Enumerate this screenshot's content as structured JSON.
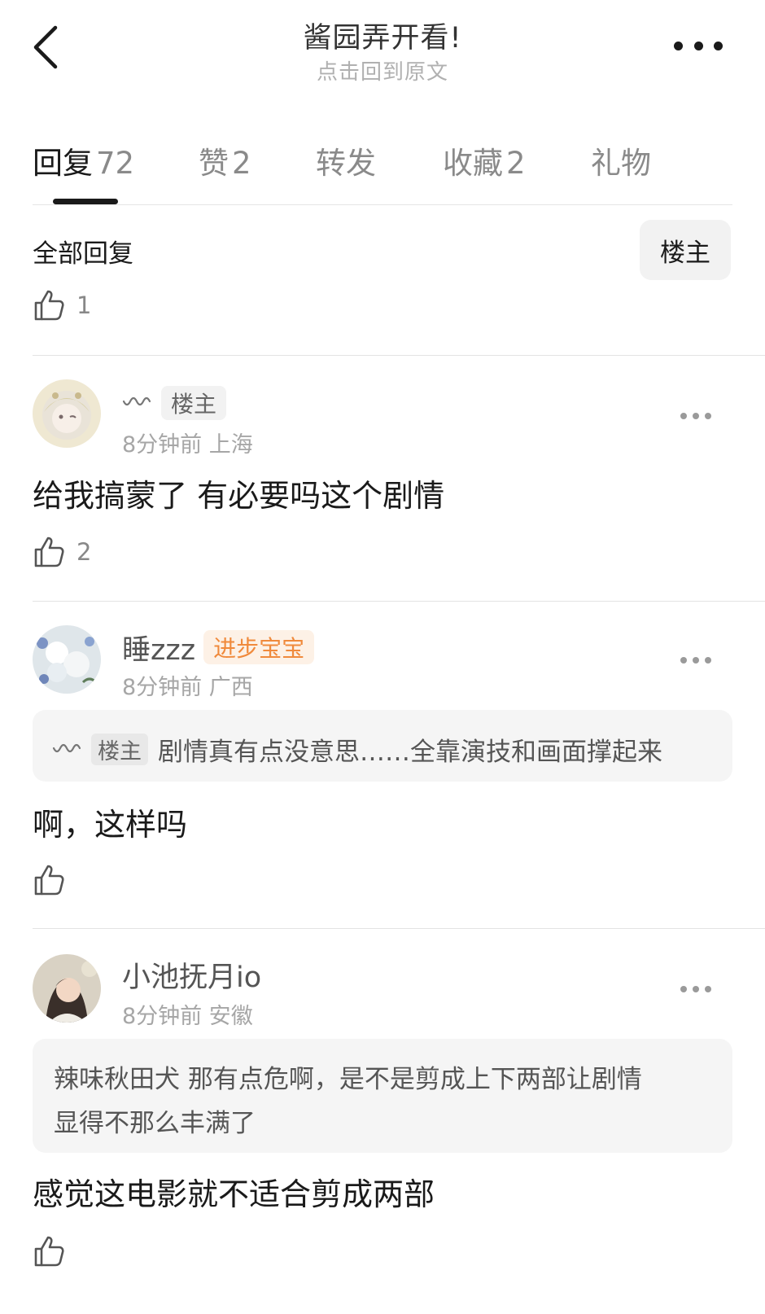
{
  "header": {
    "title": "酱园弄开看!",
    "subtitle": "点击回到原文"
  },
  "tabs": [
    {
      "label": "回复",
      "count": "72",
      "active": true
    },
    {
      "label": "赞",
      "count": "2"
    },
    {
      "label": "转发",
      "count": ""
    },
    {
      "label": "收藏",
      "count": "2"
    },
    {
      "label": "礼物",
      "count": ""
    }
  ],
  "filter": {
    "label": "全部回复",
    "owner_button": "楼主"
  },
  "post_likes": "1",
  "comments": [
    {
      "username": "",
      "tag": "楼主",
      "time": "8分钟前",
      "location": "上海",
      "content": "给我搞蒙了 有必要吗这个剧情",
      "likes": "2"
    },
    {
      "username": "睡zzz",
      "tag": "进步宝宝",
      "time": "8分钟前",
      "location": "广西",
      "quote_tag": "楼主",
      "quote_text": "剧情真有点没意思……全靠演技和画面撑起来",
      "content": "啊，这样吗",
      "likes": ""
    },
    {
      "username": "小池抚月io",
      "time": "8分钟前",
      "location": "安徽",
      "quote_name": "辣味秋田犬",
      "quote_text_line1": "那有点危啊，是不是剪成上下两部让剧情",
      "quote_text_line2": "显得不那么丰满了",
      "content": "感觉这电影就不适合剪成两部",
      "likes": ""
    }
  ],
  "colors": {
    "accent_tag_bg": "#fdf1e6",
    "accent_tag_text": "#f08a3c",
    "muted_text": "#a6a6a6"
  },
  "icons": [
    "back-arrow-icon",
    "more-icon",
    "thumbs-up-icon",
    "wave-icon",
    "more-dots-icon"
  ]
}
